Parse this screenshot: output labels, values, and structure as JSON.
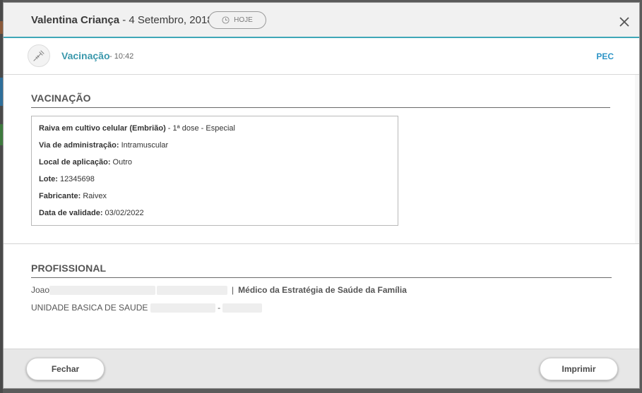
{
  "header": {
    "patient_name": "Valentina Criança",
    "date": " - 4 Setembro, 2018",
    "today_label": "HOJE"
  },
  "record": {
    "title": "Vacinação",
    "time": "- 10:42",
    "source": "PEC"
  },
  "vaccination": {
    "section_title": "VACINAÇÃO",
    "vaccine_name": "Raiva em cultivo celular (Embrião)",
    "vaccine_dose": " - 1ª dose - Especial",
    "route_label": "Via de administração:",
    "route_value": " Intramuscular",
    "site_label": "Local de aplicação:",
    "site_value": " Outro",
    "lot_label": "Lote:",
    "lot_value": " 12345698",
    "manufacturer_label": "Fabricante:",
    "manufacturer_value": " Raivex",
    "expiry_label": "Data de validade:",
    "expiry_value": " 03/02/2022"
  },
  "professional": {
    "section_title": "PROFISSIONAL",
    "first_name": "Joao",
    "separator": "|",
    "role": "Médico da Estratégia de Saúde da Família",
    "unit": "UNIDADE BASICA DE SAUDE",
    "unit_separator": "-"
  },
  "footer": {
    "close_label": "Fechar",
    "print_label": "Imprimir"
  },
  "icons": {
    "clock": "clock-icon",
    "close": "close-icon",
    "syringe": "syringe-icon"
  },
  "colors": {
    "accent": "#3fa7b7",
    "record_title": "#3a98ac",
    "source": "#2e95c7"
  }
}
